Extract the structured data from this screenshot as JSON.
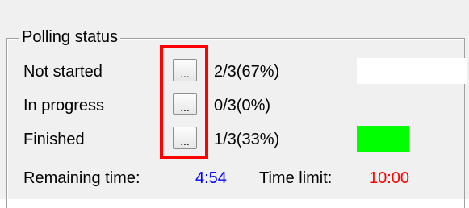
{
  "group_title": "Polling status",
  "rows": [
    {
      "label": "Not started",
      "button_label": "...",
      "count": "2/3(67%)",
      "progress": 0.67,
      "bar_color": "#ffffff"
    },
    {
      "label": "In progress",
      "button_label": "...",
      "count": "0/3(0%)",
      "progress": 0.0,
      "bar_color": "#f0f0f0"
    },
    {
      "label": "Finished",
      "button_label": "...",
      "count": "1/3(33%)",
      "progress": 0.33,
      "bar_color": "#00ff00"
    }
  ],
  "footer": {
    "remaining_label": "Remaining time:",
    "remaining_value": "4:54",
    "remaining_color": "#0000ff",
    "limit_label": "Time limit:",
    "limit_value": "10:00",
    "limit_color": "#ff0000"
  },
  "highlight_color": "#ff0000"
}
